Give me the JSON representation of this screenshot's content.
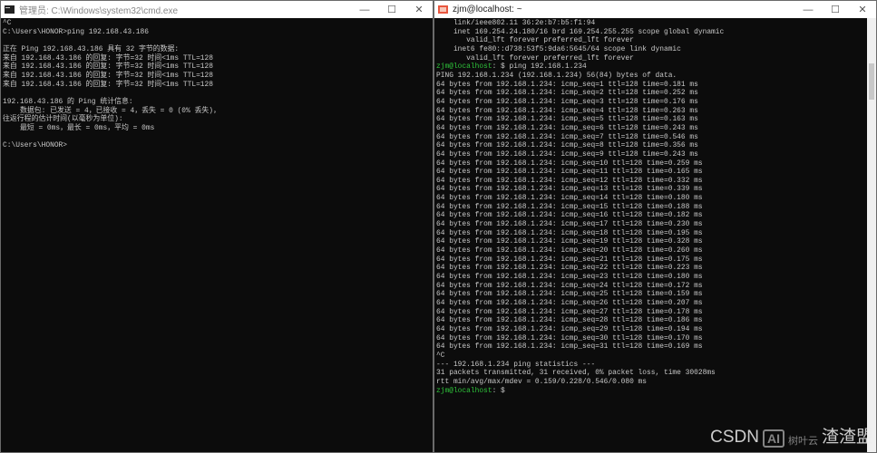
{
  "left_window": {
    "title": "管理员: C:\\Windows\\system32\\cmd.exe",
    "lines": [
      "^C",
      "C:\\Users\\HONOR>ping 192.168.43.186",
      "",
      "正在 Ping 192.168.43.186 具有 32 字节的数据:",
      "来自 192.168.43.186 的回复: 字节=32 时间<1ms TTL=128",
      "来自 192.168.43.186 的回复: 字节=32 时间<1ms TTL=128",
      "来自 192.168.43.186 的回复: 字节=32 时间<1ms TTL=128",
      "来自 192.168.43.186 的回复: 字节=32 时间<1ms TTL=128",
      "",
      "192.168.43.186 的 Ping 统计信息:",
      "    数据包: 已发送 = 4，已接收 = 4，丢失 = 0 (0% 丢失)，",
      "往返行程的估计时间(以毫秒为单位):",
      "    最短 = 0ms，最长 = 0ms，平均 = 0ms",
      "",
      "C:\\Users\\HONOR>"
    ]
  },
  "right_window": {
    "title": "zjm@localhost: ~",
    "prompt": "zjm@localhost",
    "header_lines": [
      "    link/ieee802.11 36:2e:b7:b5:f1:94",
      "    inet 169.254.24.180/16 brd 169.254.255.255 scope global dynamic",
      "       valid_lft forever preferred_lft forever",
      "    inet6 fe80::d738:53f5:9da6:5645/64 scope link dynamic",
      "       valid_lft forever preferred_lft forever"
    ],
    "command": ": $ ping 192.168.1.234",
    "ping_header": "PING 192.168.1.234 (192.168.1.234) 56(84) bytes of data.",
    "replies": [
      "0.181",
      "0.252",
      "0.176",
      "0.263",
      "0.163",
      "0.243",
      "0.546",
      "0.356",
      "0.243",
      "0.259",
      "0.165",
      "0.332",
      "0.339",
      "0.180",
      "0.188",
      "0.182",
      "0.230",
      "0.195",
      "0.328",
      "0.260",
      "0.175",
      "0.223",
      "0.180",
      "0.172",
      "0.159",
      "0.207",
      "0.178",
      "0.186",
      "0.194",
      "0.170",
      "0.169"
    ],
    "reply_prefix": "64 bytes from 192.168.1.234: icmp_seq=",
    "footer_lines": [
      "^C",
      "--- 192.168.1.234 ping statistics ---",
      "31 packets transmitted, 31 received, 0% packet loss, time 30028ms",
      "rtt min/avg/max/mdev = 0.159/0.228/0.546/0.080 ms"
    ],
    "final_prompt_suffix": ": $"
  },
  "watermark": {
    "ai": "AI",
    "brand_small": "树叶云",
    "csdn": "CSDN",
    "brand": "渣渣盟"
  },
  "controls": {
    "minimize": "—",
    "maximize": "☐",
    "close": "✕"
  }
}
